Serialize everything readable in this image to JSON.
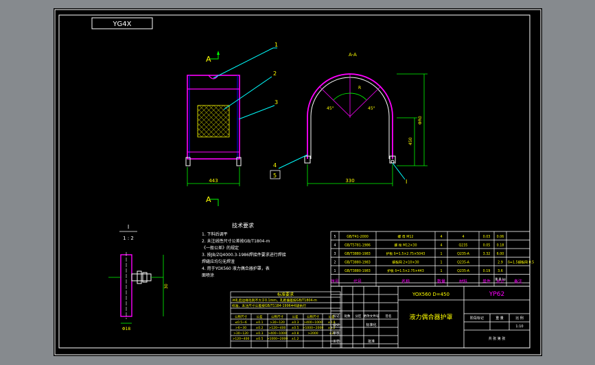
{
  "colors": {
    "background": "#000000",
    "frame": "#ffffff",
    "outline": "#ff00ff",
    "dimension": "#00ff00",
    "leader": "#00ffff",
    "text": "#ffff00",
    "titleblock": "#ffffff"
  },
  "sheet": {
    "code_box": "YG4X"
  },
  "views": {
    "front_label_top": "A",
    "front_label_bottom": "A",
    "section_title": "A-A",
    "detail_title": "I",
    "detail_scale": "1 : 2"
  },
  "front_view": {
    "width_dim": "443",
    "balloons": [
      "1",
      "2",
      "3"
    ]
  },
  "section_view": {
    "width_dim": "330",
    "height_dim_1": "450",
    "height_dim_2": "ΦR0",
    "angle_left": "45°",
    "angle_right": "45°",
    "radius": "R",
    "balloons": [
      "4",
      "5",
      "I"
    ]
  },
  "detail_view": {
    "dim_1": "30",
    "dim_2": "Φ18"
  },
  "tech_notes": {
    "title": "技术要求",
    "lines": [
      "1. 下料后调平",
      "2. 未注线性尺寸公差按GB/T1804-m",
      "   《一般公差》的规定",
      "3. 按JB/ZQ4000.3-1986焊接件要求进行焊接",
      "   焊缝应均匀无焊渣",
      "4. 用于YOX560 液力偶合器护罩，表",
      "   面喷涂"
    ]
  },
  "note_table": {
    "title": "标准要求",
    "rows": [
      "冲孔后边缘毛刺不大于0.1mm，孔距偏差按GB/T1804-m",
      "标准，未注尺寸公差按GB/T1184-1996中K级执行"
    ],
    "headers": [
      "公称尺寸",
      "公差",
      "公称尺寸",
      "公差",
      "公称尺寸",
      "公差"
    ],
    "data": [
      [
        "≤0.5~6",
        "±0.1",
        ">30~120",
        "±0.3",
        ">400~1000",
        "±0.8"
      ],
      [
        ">6~30",
        "±0.2",
        ">120~400",
        "±0.5",
        ">1000~2000",
        "±1.2"
      ],
      [
        ">30~120",
        "±0.3",
        ">400~1000",
        "±0.8",
        ">2000",
        "±2"
      ],
      [
        ">120~400",
        "±0.5",
        ">1000~2000",
        "±1.2",
        "",
        ""
      ]
    ]
  },
  "bom": {
    "rows": [
      [
        "5",
        "GB/T41-2000",
        "螺 母 M12",
        "4",
        "4",
        "0.03",
        "0.06",
        ""
      ],
      [
        "4",
        "GB/T5781-1986",
        "螺 栓 M12×30",
        "4",
        "Q235",
        "0.05",
        "0.18",
        ""
      ],
      [
        "3",
        "GB/T3880-1983",
        "护板 δ=1.5×2.75×5043",
        "1",
        "Q235-A",
        "3.32",
        "6.00",
        ""
      ],
      [
        "2",
        "GB/T3880-1983",
        "钢板网 2×10×30",
        "1",
        "Q235-A",
        "",
        "2.9",
        "δ=1.5钢板网 0.5"
      ],
      [
        "1",
        "GB/T3880-1983",
        "护板 δ=1.5×2.75×443",
        "1",
        "Q235-A",
        "0.19",
        "3.6",
        ""
      ]
    ],
    "header": [
      "序号",
      "代号",
      "名称",
      "数量",
      "材料",
      "单件",
      "总计",
      "备注"
    ],
    "weight_label": "重 量 kg"
  },
  "title_block": {
    "model": "YOX560 D=450",
    "code": "YP62",
    "name": "液力偶合器护罩",
    "stage_label": "阶段标记",
    "weight_label": "重 量",
    "scale_label": "比 例",
    "scale_value": "1:10",
    "sheet_label": "共  张  第  张",
    "left_headers": [
      "标记",
      "处数",
      "分区",
      "更改文件号",
      "签名",
      "年月日"
    ],
    "design": "设计",
    "standard": "标准化",
    "review": "审核",
    "process": "工艺",
    "approve": "批准"
  }
}
